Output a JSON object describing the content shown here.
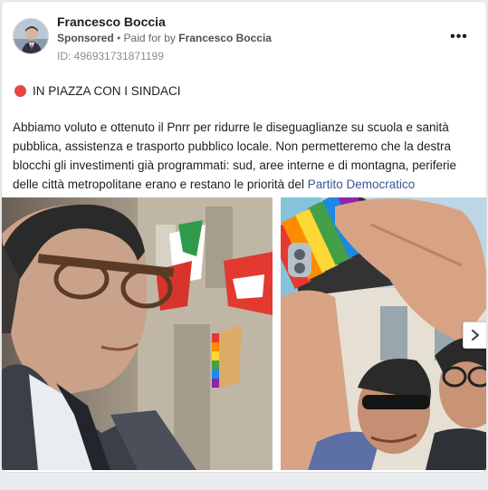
{
  "post": {
    "page_name": "Francesco Boccia",
    "sponsored_label": "Sponsored",
    "paid_for_prefix": " • Paid for by ",
    "paid_for_name": "Francesco Boccia",
    "ad_id": "ID: 496931731871199",
    "more_icon": "more-options-icon",
    "headline": "IN PIAZZA CON I SINDACI",
    "body": "Abbiamo voluto e ottenuto il Pnrr per ridurre le diseguaglianze su scuola e sanità pubblica, assistenza e trasporto pubblico locale. Non permetteremo che la destra blocchi gli investimenti già programmati: sud, aree interne e di montagna, periferie delle città metropolitane erano e restano le priorità del ",
    "body_link": "Partito Democratico"
  },
  "carousel": {
    "next_icon": "chevron-right-icon"
  },
  "colors": {
    "link": "#385898",
    "red_dot": "#e84545",
    "meta_gray": "#65676b"
  }
}
